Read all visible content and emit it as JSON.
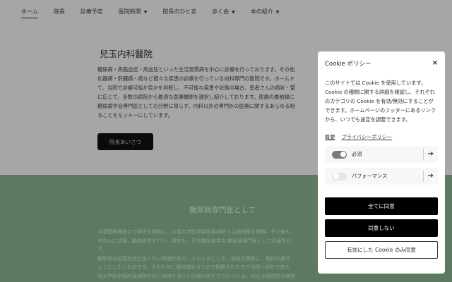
{
  "nav": [
    {
      "label": "ホーム",
      "active": true
    },
    {
      "label": "院長"
    },
    {
      "label": "診療予定"
    },
    {
      "label": "医院新聞",
      "dropdown": true
    },
    {
      "label": "院長のひと言"
    },
    {
      "label": "歩く会",
      "dropdown": true
    },
    {
      "label": "本の紹介",
      "dropdown": true
    }
  ],
  "hero": {
    "title": "兒玉内科醫院",
    "lines": [
      "糖尿病・高脂血症・高血圧といった生活習慣病を中心に診療を行っております。その他",
      "化器病・肝臓病・癌など様々な疾患の診療を行っている内科専門の医院です。ホームド",
      "て、当院で診療可能か否かを判断し、不可能な疾患や状態の場合、患者さんの病状・緊",
      "に応じて、多数の病院から最適な医療機関を選択し紹介しております。医療の最前線に",
      "糖尿病学会専門医としての分野に限らず、内科以外の専門外の医療に関するあらゆる相",
      "ることをモットーにしています。"
    ],
    "button": "院長あいさつ"
  },
  "section": {
    "title": "糖尿病専門医として",
    "lines": [
      "大阪警察病院にて研修を開始し、大阪大学医学部附属病院では病棟医を経験。その後も",
      "を中心に診療、臨床研究を行い、現在も、日本糖尿病学会 糖尿病専門医として診療を行",
      "す。",
      "糖尿病は自覚症状が全くない時期があり、そのときにこそ、病気を理解し、病状の進行",
      "ようにしたいものです。そのために糖尿病をはじめて指摘された方が当院へ初診で来る",
      "阪大学医学部附属病院や同じ研修を受けた同僚の医生方がおられる。例えば関西労災病院"
    ]
  },
  "cookie": {
    "title": "Cookie ポリシー",
    "close": "×",
    "body": "このサイトでは Cookie を使用しています。Cookie の種類に関する詳細を確認し、それぞれのカテゴリの Cookie を有効/無効にすることができます。ホームページのフッターにあるリンクから、いつでも設定を調整できます。",
    "links": [
      "概要",
      "プライバシーポリシー"
    ],
    "categories": [
      {
        "label": "必須",
        "enabled": true
      },
      {
        "label": "パフォーマンス",
        "enabled": false
      }
    ],
    "arrow": "➔",
    "accept_all": "全てに同意",
    "decline": "同意しない",
    "accept_selected": "有効にした Cookie のみ同意"
  }
}
